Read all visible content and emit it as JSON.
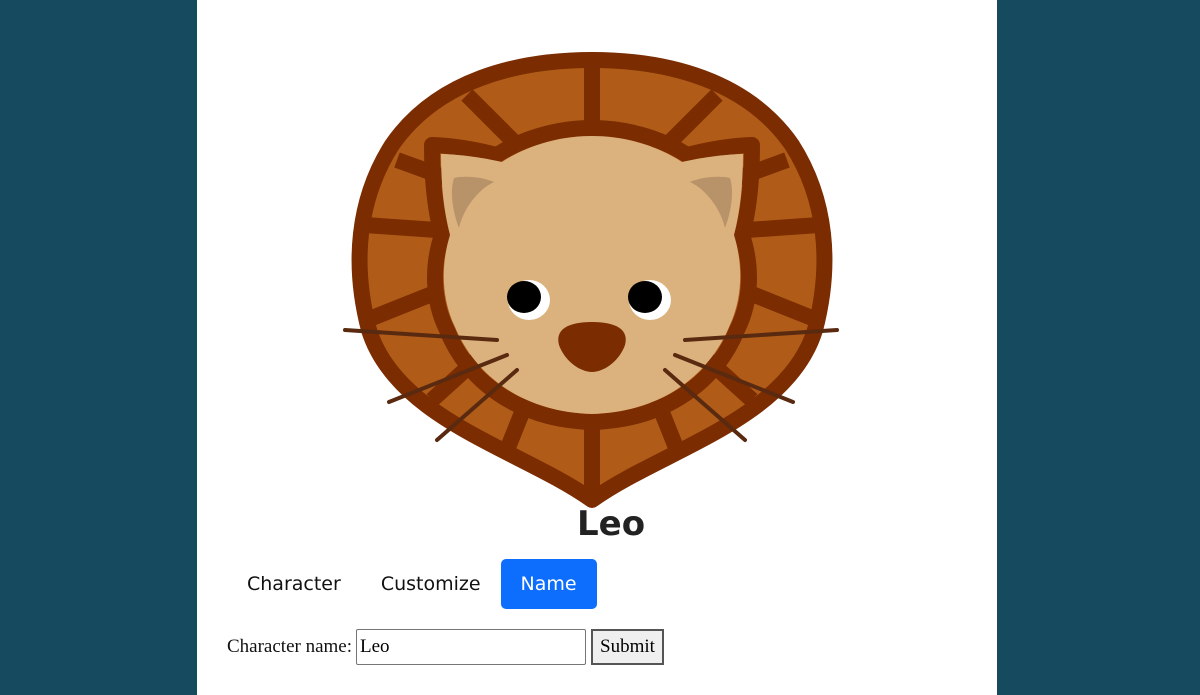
{
  "character": {
    "name": "Leo",
    "illustration": "lion-avatar"
  },
  "tabs": [
    {
      "label": "Character",
      "active": false
    },
    {
      "label": "Customize",
      "active": false
    },
    {
      "label": "Name",
      "active": true
    }
  ],
  "form": {
    "label": "Character name:",
    "value": "Leo",
    "submit_label": "Submit"
  },
  "colors": {
    "background": "#164a5e",
    "mane_outline": "#7b2c00",
    "mane_fill": "#b05c18",
    "face": "#dbb27e",
    "inner_ear": "#b8936a",
    "whiskers": "#5a2a10",
    "accent": "#0d6efd"
  }
}
